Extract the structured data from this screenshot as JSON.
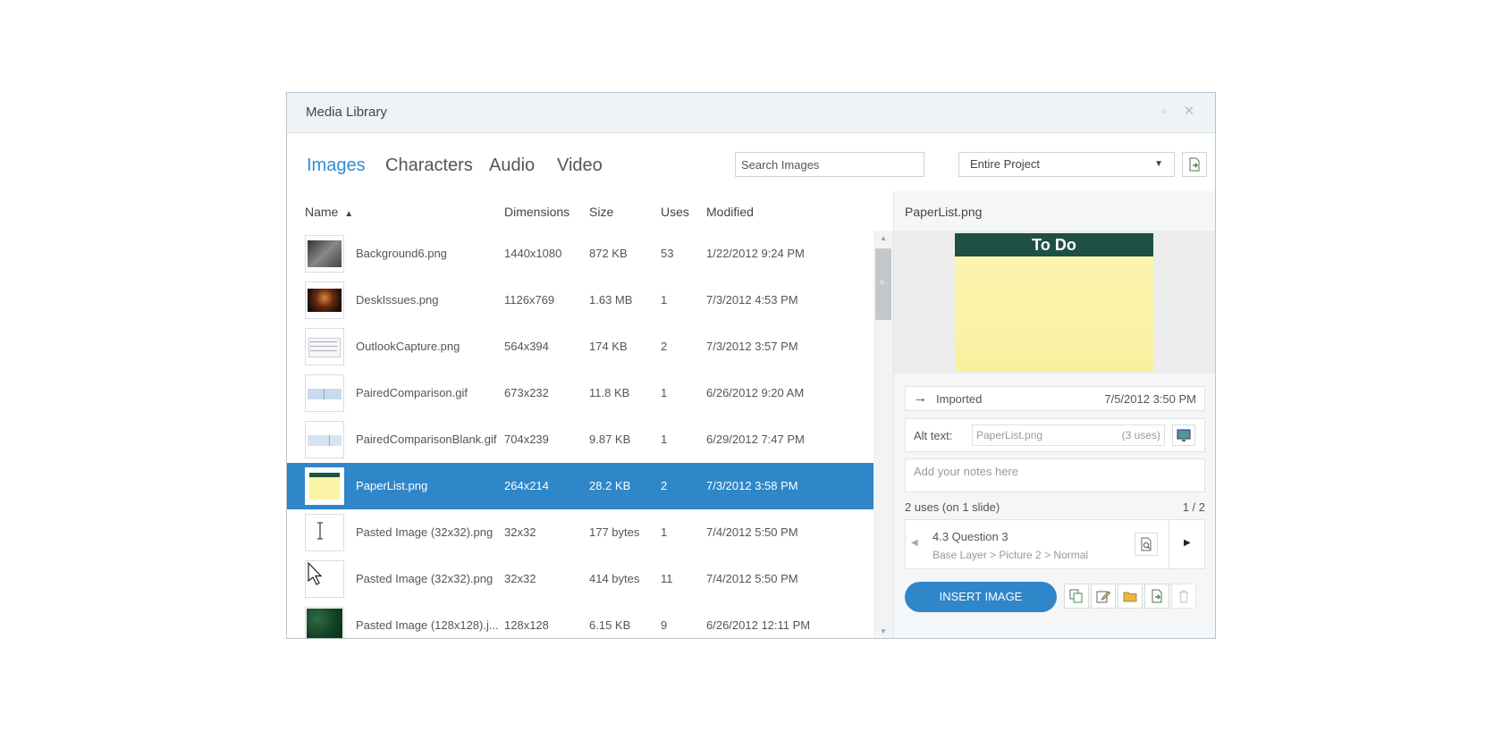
{
  "window": {
    "title": "Media Library"
  },
  "tabs": [
    {
      "label": "Images",
      "active": true
    },
    {
      "label": "Characters",
      "active": false
    },
    {
      "label": "Audio",
      "active": false
    },
    {
      "label": "Video",
      "active": false
    }
  ],
  "search": {
    "placeholder": "Search Images"
  },
  "scope": {
    "value": "Entire Project"
  },
  "table": {
    "columns": {
      "name": "Name",
      "dimensions": "Dimensions",
      "size": "Size",
      "uses": "Uses",
      "modified": "Modified"
    },
    "sort_indicator": "▲",
    "rows": [
      {
        "name": "Background6.png",
        "dimensions": "1440x1080",
        "size": "872 KB",
        "uses": "53",
        "modified": "1/22/2012 9:24 PM"
      },
      {
        "name": "DeskIssues.png",
        "dimensions": "1126x769",
        "size": "1.63 MB",
        "uses": "1",
        "modified": "7/3/2012 4:53 PM"
      },
      {
        "name": "OutlookCapture.png",
        "dimensions": "564x394",
        "size": "174 KB",
        "uses": "2",
        "modified": "7/3/2012 3:57 PM"
      },
      {
        "name": "PairedComparison.gif",
        "dimensions": "673x232",
        "size": "11.8 KB",
        "uses": "1",
        "modified": "6/26/2012 9:20 AM"
      },
      {
        "name": "PairedComparisonBlank.gif",
        "dimensions": "704x239",
        "size": "9.87 KB",
        "uses": "1",
        "modified": "6/29/2012 7:47 PM"
      },
      {
        "name": "PaperList.png",
        "dimensions": "264x214",
        "size": "28.2 KB",
        "uses": "2",
        "modified": "7/3/2012 3:58 PM"
      },
      {
        "name": "Pasted Image (32x32).png",
        "dimensions": "32x32",
        "size": "177 bytes",
        "uses": "1",
        "modified": "7/4/2012 5:50 PM"
      },
      {
        "name": "Pasted Image (32x32).png",
        "dimensions": "32x32",
        "size": "414 bytes",
        "uses": "11",
        "modified": "7/4/2012 5:50 PM"
      },
      {
        "name": "Pasted Image (128x128).j...",
        "dimensions": "128x128",
        "size": "6.15 KB",
        "uses": "9",
        "modified": "6/26/2012 12:11 PM"
      }
    ],
    "selected_index": 5
  },
  "detail": {
    "filename": "PaperList.png",
    "preview_heading": "To Do",
    "imported_label": "Imported",
    "imported_date": "7/5/2012 3:50 PM",
    "alt_label": "Alt text:",
    "alt_value": "PaperList.png",
    "alt_uses": "(3 uses)",
    "notes_placeholder": "Add your notes here",
    "uses_summary": "2 uses (on 1 slide)",
    "pager": "1 / 2",
    "slide_title": "4.3 Question 3",
    "slide_path": "Base Layer > Picture 2 > Normal",
    "insert_label": "INSERT IMAGE"
  },
  "colors": {
    "accent": "#2f86c8",
    "tab_active": "#2f8fd0",
    "note_header": "#1f5044",
    "note_body": "#fdf6b0"
  }
}
